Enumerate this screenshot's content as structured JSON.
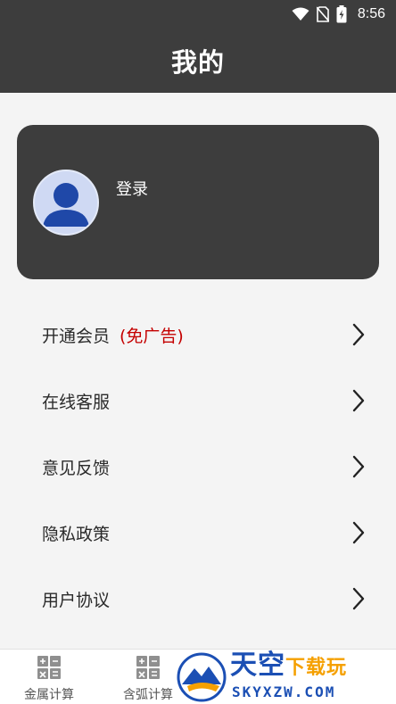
{
  "status_bar": {
    "time": "8:56",
    "icons": [
      "wifi-icon",
      "no-sim-icon",
      "battery-charging-icon"
    ]
  },
  "header": {
    "title": "我的"
  },
  "profile": {
    "login_label": "登录",
    "avatar_icon": "user-avatar-icon"
  },
  "menu": {
    "items": [
      {
        "label": "开通会员",
        "note": "(免广告)"
      },
      {
        "label": "在线客服"
      },
      {
        "label": "意见反馈"
      },
      {
        "label": "隐私政策"
      },
      {
        "label": "用户协议"
      }
    ]
  },
  "bottom_nav": {
    "items": [
      {
        "label": "金属计算",
        "icon": "calculator-icon"
      },
      {
        "label": "含弧计算",
        "icon": "calculator-icon"
      }
    ]
  },
  "watermark": {
    "title_main": "天空",
    "title_accent": "下载玩",
    "url": "SKYXZW.COM"
  },
  "colors": {
    "header_bg": "#3d3d3d",
    "page_bg": "#f4f4f4",
    "note_red": "#c40000",
    "avatar_blue": "#1f48a8"
  }
}
